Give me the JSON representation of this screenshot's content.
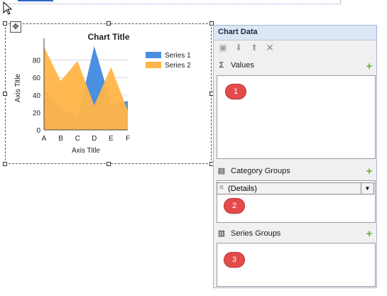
{
  "chart": {
    "title": "Chart Title",
    "x_axis_title": "Axis Title",
    "y_axis_title": "Axis Title"
  },
  "chart_data": {
    "type": "area",
    "title": "Chart Title",
    "xlabel": "Axis Title",
    "ylabel": "Axis Title",
    "categories": [
      "A",
      "B",
      "C",
      "D",
      "E",
      "F"
    ],
    "ylim": [
      0,
      100
    ],
    "yticks": [
      0,
      20,
      40,
      60,
      80
    ],
    "grid": true,
    "legend": "right",
    "series": [
      {
        "name": "Series 1",
        "color": "#4a8fe0",
        "values": [
          46,
          25,
          15,
          96,
          30,
          33
        ]
      },
      {
        "name": "Series 2",
        "color": "#ffb547",
        "values": [
          95,
          56,
          79,
          28,
          72,
          22
        ]
      }
    ]
  },
  "pane": {
    "title": "Chart Data",
    "toolbar_icons": [
      "properties-icon",
      "move-down-icon",
      "move-up-icon",
      "delete-icon"
    ],
    "values_label": "Values",
    "category_groups_label": "Category Groups",
    "category_group_item": "(Details)",
    "series_groups_label": "Series Groups"
  },
  "badges": {
    "one": "1",
    "two": "2",
    "three": "3"
  },
  "colors": {
    "accent_add": "#6cb22a",
    "badge": "#e34b4b",
    "pane_header": "#dce6f4"
  }
}
